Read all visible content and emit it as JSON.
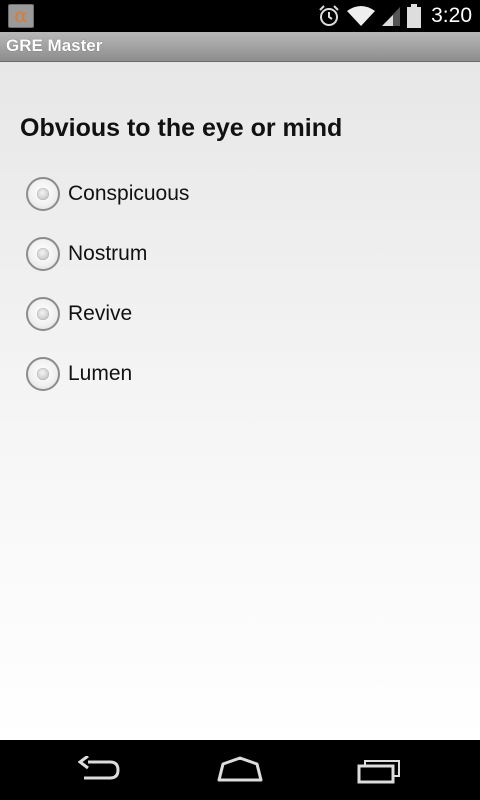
{
  "status_bar": {
    "notification_icon": "alpha-app-icon",
    "notification_glyph": "α",
    "icons": [
      "alarm-icon",
      "wifi-icon",
      "signal-icon",
      "battery-icon"
    ],
    "time": "3:20"
  },
  "app_bar": {
    "title": "GRE Master"
  },
  "quiz": {
    "question": "Obvious to the eye or mind",
    "options": [
      {
        "label": "Conspicuous",
        "selected": false
      },
      {
        "label": "Nostrum",
        "selected": false
      },
      {
        "label": "Revive",
        "selected": false
      },
      {
        "label": "Lumen",
        "selected": false
      }
    ]
  },
  "nav_bar": {
    "buttons": [
      "back-icon",
      "home-icon",
      "recent-apps-icon"
    ]
  },
  "colors": {
    "status_bar_bg": "#000000",
    "title_bar_bg": "#a3a3a3",
    "content_bg_top": "#e7e7e7",
    "content_bg_bottom": "#ffffff",
    "text": "#111111",
    "notif_accent": "#e07a2e"
  }
}
